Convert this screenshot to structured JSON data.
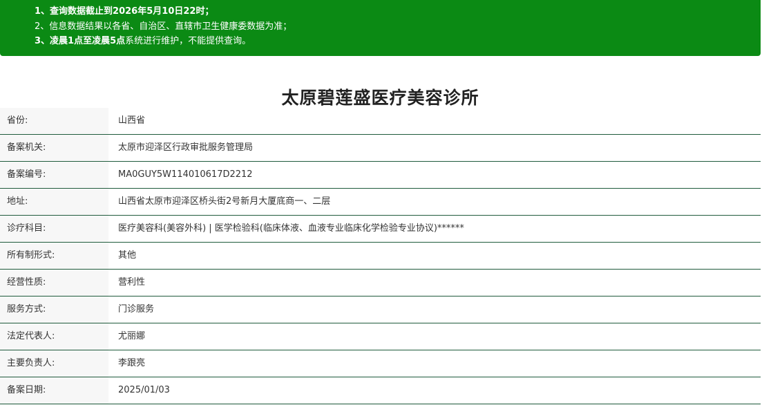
{
  "notice": {
    "line1": "1、查询数据截止到2026年5月10日22时；",
    "line2": "2、信息数据结果以各省、自治区、直辖市卫生健康委数据为准；",
    "line3_bold": "3、凌晨1点至凌晨5点",
    "line3_rest": "系统进行维护，不能提供查询。"
  },
  "clinic": {
    "name": "太原碧莲盛医疗美容诊所"
  },
  "rows": [
    {
      "label": "省份:",
      "value": "山西省"
    },
    {
      "label": "备案机关:",
      "value": "太原市迎泽区行政审批服务管理局"
    },
    {
      "label": "备案编号:",
      "value": "MA0GUY5W114010617D2212"
    },
    {
      "label": "地址:",
      "value": "山西省太原市迎泽区桥头街2号新月大厦底商一、二层"
    },
    {
      "label": "诊疗科目:",
      "value": "医疗美容科(美容外科) | 医学检验科(临床体液、血液专业临床化学检验专业协议)******"
    },
    {
      "label": "所有制形式:",
      "value": "其他"
    },
    {
      "label": "经营性质:",
      "value": "营利性"
    },
    {
      "label": "服务方式:",
      "value": "门诊服务"
    },
    {
      "label": "法定代表人:",
      "value": "尤丽娜"
    },
    {
      "label": "主要负责人:",
      "value": "李跟亮"
    },
    {
      "label": "备案日期:",
      "value": "2025/01/03"
    }
  ],
  "colors": {
    "notice_bg": "#0b8a14",
    "row_border": "#1e5a3b",
    "label_bg": "#f7f7f7"
  }
}
